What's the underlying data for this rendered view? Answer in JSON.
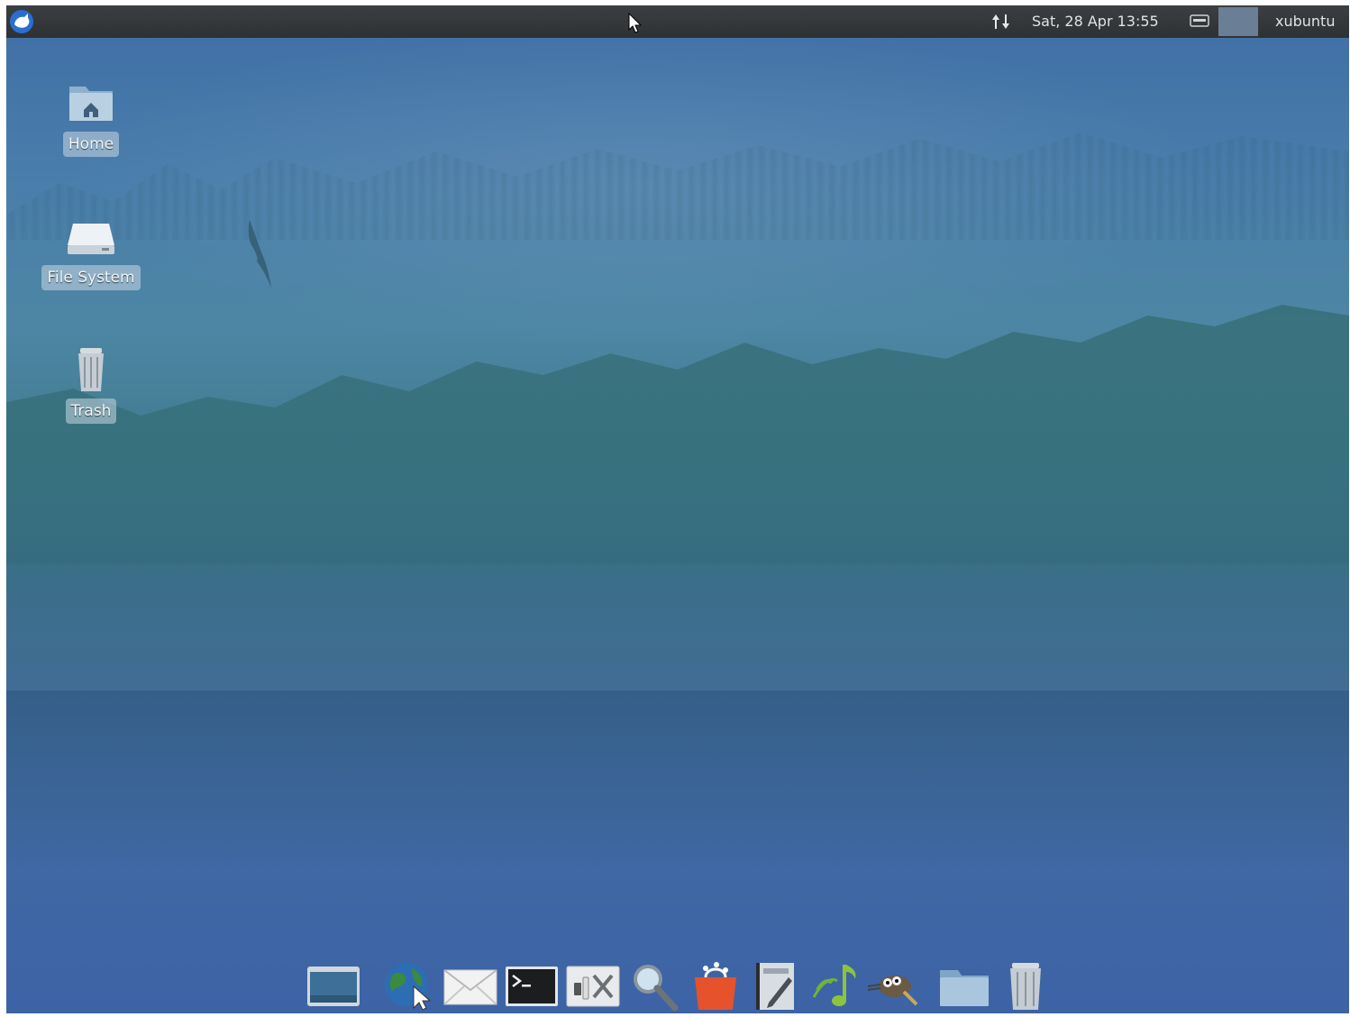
{
  "top_panel": {
    "clock": "Sat, 28 Apr  13:55",
    "user": "xubuntu"
  },
  "desktop": {
    "icons": [
      {
        "label": "Home",
        "icon": "home-folder-icon"
      },
      {
        "label": "File System",
        "icon": "drive-icon"
      },
      {
        "label": "Trash",
        "icon": "trash-icon"
      }
    ]
  },
  "dock": {
    "items": [
      "show-desktop-icon",
      "web-browser-icon",
      "mail-icon",
      "terminal-icon",
      "settings-manager-icon",
      "app-finder-search-icon",
      "software-center-icon",
      "text-editor-icon",
      "music-player-icon",
      "image-editor-icon",
      "file-manager-icon",
      "trash-icon"
    ]
  },
  "colors": {
    "panel": "#2e3134",
    "wallpaper_top": "#3f6ea6",
    "wallpaper_mid": "#3f7a8e",
    "wallpaper_bottom": "#3d63a6"
  }
}
